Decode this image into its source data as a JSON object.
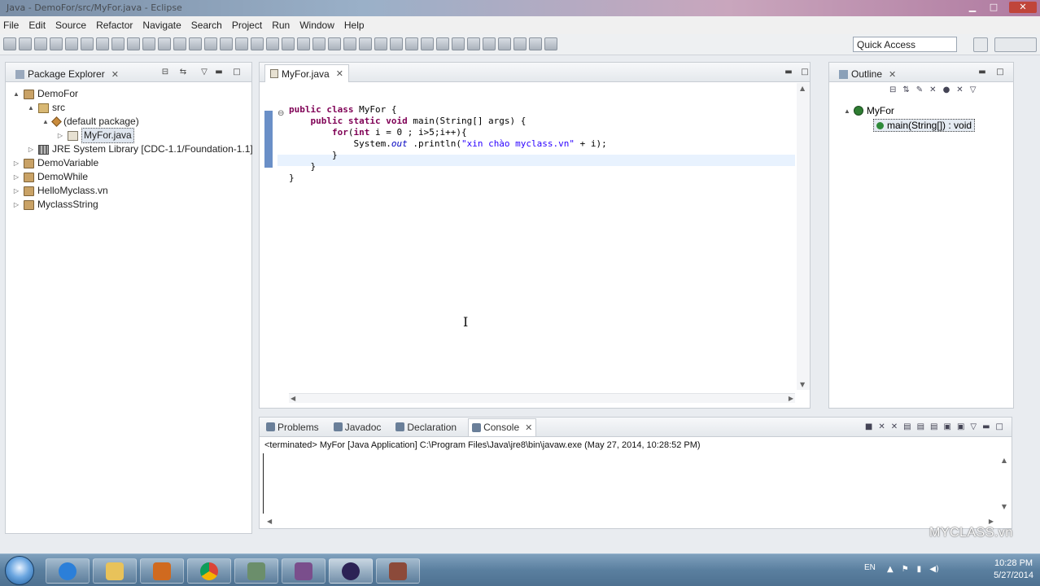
{
  "window": {
    "title": "Java - DemoFor/src/MyFor.java - Eclipse"
  },
  "menu": [
    "File",
    "Edit",
    "Source",
    "Refactor",
    "Navigate",
    "Search",
    "Project",
    "Run",
    "Window",
    "Help"
  ],
  "toolbar": {
    "quick_access": "Quick Access"
  },
  "package_explorer": {
    "title": "Package Explorer",
    "tree": [
      {
        "label": "DemoFor",
        "depth": 0,
        "twisty": "▲",
        "icon": "project"
      },
      {
        "label": "src",
        "depth": 1,
        "twisty": "▲",
        "icon": "src"
      },
      {
        "label": "(default package)",
        "depth": 2,
        "twisty": "▲",
        "icon": "package"
      },
      {
        "label": "MyFor.java",
        "depth": 3,
        "twisty": "▷",
        "icon": "java",
        "selected": true
      },
      {
        "label": "JRE System Library [CDC-1.1/Foundation-1.1]",
        "depth": 1,
        "twisty": "▷",
        "icon": "library"
      },
      {
        "label": "DemoVariable",
        "depth": 0,
        "twisty": "▷",
        "icon": "project"
      },
      {
        "label": "DemoWhile",
        "depth": 0,
        "twisty": "▷",
        "icon": "project"
      },
      {
        "label": "HelloMyclass.vn",
        "depth": 0,
        "twisty": "▷",
        "icon": "project"
      },
      {
        "label": "MyclassString",
        "depth": 0,
        "twisty": "▷",
        "icon": "project"
      }
    ]
  },
  "editor": {
    "tab": "MyFor.java",
    "code": [
      {
        "t": [
          [
            "kw",
            "public "
          ],
          [
            "kw",
            "class "
          ],
          [
            "",
            "MyFor {"
          ]
        ]
      },
      {
        "t": [
          [
            "",
            "    "
          ],
          [
            "kw",
            "public "
          ],
          [
            "kw",
            "static "
          ],
          [
            "kw",
            "void "
          ],
          [
            "",
            "main(String[] args) {"
          ]
        ]
      },
      {
        "t": [
          [
            "",
            "        "
          ],
          [
            "kw",
            "for"
          ],
          [
            "",
            "("
          ],
          [
            "kw",
            "int "
          ],
          [
            "",
            "i = 0 ; i>5;i++){"
          ]
        ]
      },
      {
        "t": [
          [
            "",
            "            System."
          ],
          [
            "fld",
            "out"
          ],
          [
            "",
            " .println("
          ],
          [
            "str",
            "\"xin chào myclass.vn\""
          ],
          [
            "",
            " + i);"
          ]
        ]
      },
      {
        "t": [
          [
            "",
            "        }"
          ]
        ]
      },
      {
        "t": [
          [
            "",
            "    }"
          ]
        ]
      },
      {
        "t": [
          [
            "",
            "}"
          ]
        ]
      }
    ]
  },
  "outline": {
    "title": "Outline",
    "class_name": "MyFor",
    "method": "main(String[]) : void"
  },
  "console": {
    "tabs": [
      "Problems",
      "Javadoc",
      "Declaration",
      "Console"
    ],
    "active_tab": "Console",
    "status": "<terminated> MyFor [Java Application] C:\\Program Files\\Java\\jre8\\bin\\javaw.exe (May 27, 2014, 10:28:52 PM)"
  },
  "watermark": "MYCLASS.vn",
  "taskbar": {
    "lang": "EN",
    "time": "10:28 PM",
    "date": "5/27/2014"
  }
}
